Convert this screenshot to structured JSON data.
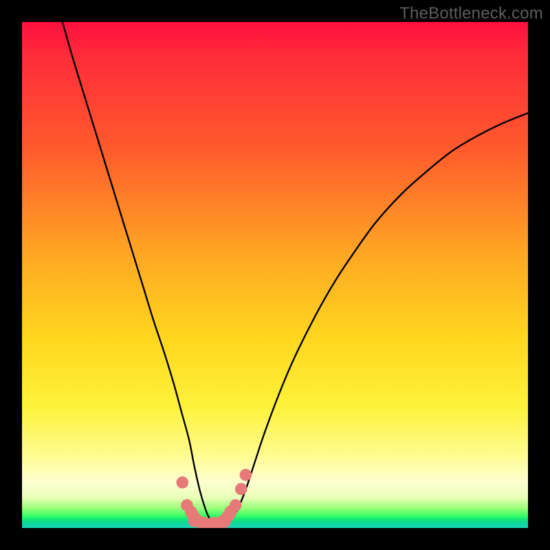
{
  "watermark": "TheBottleneck.com",
  "chart_data": {
    "type": "line",
    "title": "",
    "xlabel": "",
    "ylabel": "",
    "xlim": [
      0,
      100
    ],
    "ylim": [
      0,
      100
    ],
    "grid": false,
    "legend": false,
    "series": [
      {
        "name": "bottleneck-curve",
        "color": "#000000",
        "x": [
          8,
          10,
          12,
          14,
          16,
          18,
          20,
          22,
          24,
          26,
          28,
          30,
          31.5,
          33,
          34,
          35,
          36,
          37,
          38.5,
          40,
          42,
          44,
          46,
          48,
          51,
          54,
          58,
          62,
          66,
          70,
          75,
          80,
          85,
          90,
          95,
          100
        ],
        "values": [
          100,
          93,
          86.5,
          80,
          73.5,
          67,
          60.5,
          54,
          47.5,
          41,
          35,
          28.5,
          23,
          17.5,
          12.5,
          8,
          4.5,
          2,
          0.5,
          0.3,
          2.5,
          7,
          13,
          19,
          27,
          34,
          42,
          49,
          55,
          60.5,
          66,
          70.5,
          74.5,
          77.5,
          80,
          82
        ]
      }
    ],
    "markers": [
      {
        "name": "dot-left-upper",
        "x": 31.7,
        "y": 9.0,
        "r": 1.2,
        "color": "#e77a78"
      },
      {
        "name": "dot-left-lower",
        "x": 32.6,
        "y": 4.5,
        "r": 1.2,
        "color": "#e77a78"
      },
      {
        "name": "dot-bottom-1",
        "x": 34.0,
        "y": 1.4,
        "r": 1.2,
        "color": "#e77a78"
      },
      {
        "name": "dot-bottom-2",
        "x": 36.0,
        "y": 1.0,
        "r": 1.2,
        "color": "#e77a78"
      },
      {
        "name": "dot-bottom-3",
        "x": 38.0,
        "y": 1.0,
        "r": 1.2,
        "color": "#e77a78"
      },
      {
        "name": "dot-bottom-4",
        "x": 40.0,
        "y": 1.2,
        "r": 1.2,
        "color": "#e77a78"
      },
      {
        "name": "dot-right-lower",
        "x": 42.2,
        "y": 4.5,
        "r": 1.2,
        "color": "#e77a78"
      },
      {
        "name": "dot-right-mid",
        "x": 43.3,
        "y": 7.7,
        "r": 1.2,
        "color": "#e77a78"
      },
      {
        "name": "dot-right-upper",
        "x": 44.2,
        "y": 10.5,
        "r": 1.2,
        "color": "#e77a78"
      }
    ],
    "trough_segment": {
      "name": "valley-floor",
      "color": "#e77a78",
      "width": 2.4,
      "x": [
        33.4,
        34.5,
        36.0,
        37.5,
        39.0,
        40.3,
        41.3
      ],
      "values": [
        3.2,
        1.6,
        0.9,
        0.8,
        1.0,
        1.8,
        3.3
      ]
    }
  }
}
